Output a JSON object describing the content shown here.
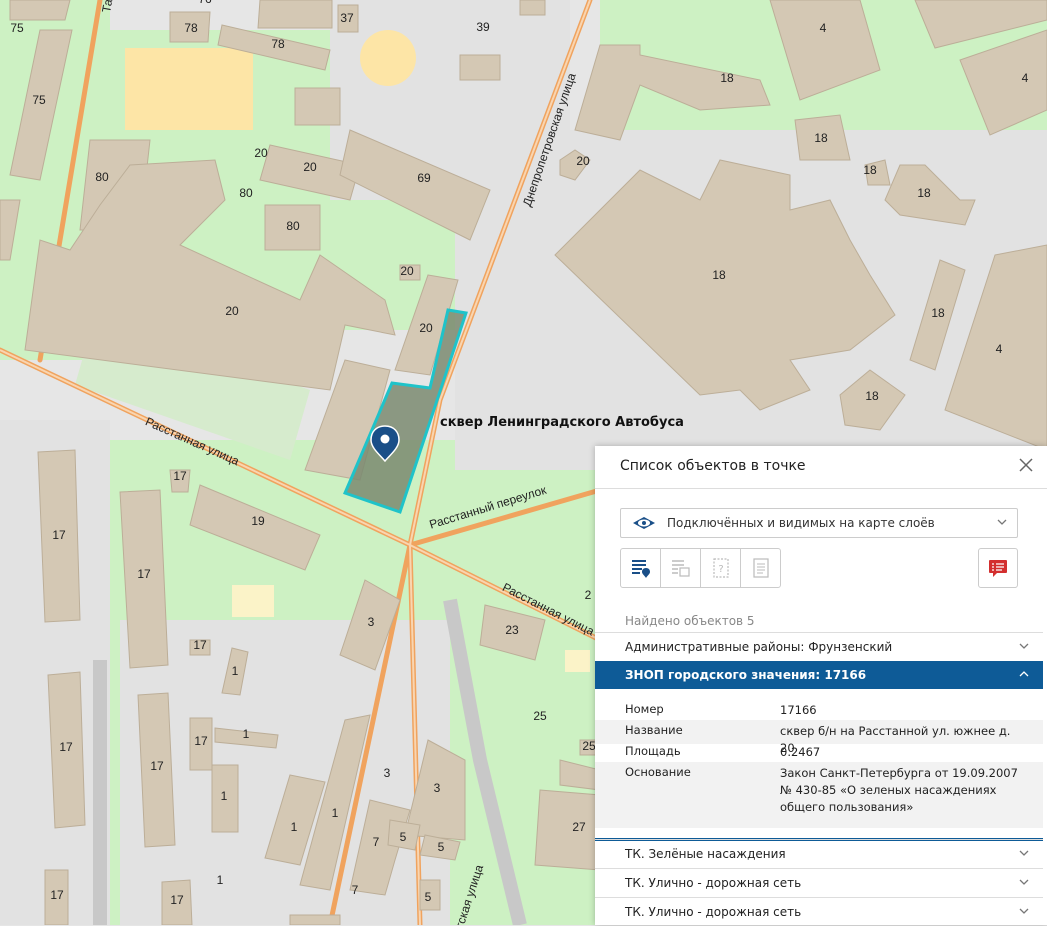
{
  "map": {
    "highlight_label": "сквер Ленинградского Автобуса",
    "streets": {
      "dnepropetrovskaya": "Днепропетровская улица",
      "rasstannaya_1": "Расстанная улица",
      "rasstannaya_2": "Расстанная улица",
      "rasstanny_per": "Расстанный переулок",
      "partial_t": "Та",
      "partial_bottom": "тская улица"
    },
    "building_numbers": {
      "b75a": "75",
      "b78a": "78",
      "b78b": "78",
      "b37": "37",
      "b39": "39",
      "b75b": "75",
      "b76": "76",
      "b18a": "18",
      "b4a": "4",
      "b4b": "4",
      "b18b": "18",
      "b20a": "20",
      "b80a": "80",
      "b20b": "20",
      "b20c": "20",
      "b69": "69",
      "b80b": "80",
      "b80c": "80",
      "b18c": "18",
      "b18d": "18",
      "b18big": "18",
      "b20d": "20",
      "b20e": "20",
      "b20main": "20",
      "b18e": "18",
      "b4c": "4",
      "b18f": "18",
      "b17a": "17",
      "b17b": "17",
      "b17c": "17",
      "b19": "19",
      "b3a": "3",
      "b23": "23",
      "b17d": "17",
      "b1a": "1",
      "b17e": "17",
      "b1b": "1",
      "b17f": "17",
      "b1c": "1",
      "b25": "25",
      "b25b": "25",
      "b3b": "3",
      "b3c": "3",
      "b1d": "1",
      "b1e": "1",
      "b7a": "7",
      "b5a": "5",
      "b5b": "5",
      "b7b": "7",
      "b27": "27",
      "b17g": "17",
      "b17h": "17",
      "b1f": "1",
      "b5c": "5",
      "b2": "2"
    },
    "colors": {
      "building": "#d4c8b4",
      "green": "#cdf1c3",
      "road": "#f0a35e",
      "highlight_stroke": "#1fc3c9",
      "highlight_fill": "#7a8a70"
    }
  },
  "panel": {
    "title": "Список объектов в точке",
    "layer_select": "Подключённых и видимых на карте слоёв",
    "found_text": "Найдено объектов 5",
    "rows": [
      {
        "label": "Административные районы: Фрунзенский"
      },
      {
        "label": "ЗНОП городского значения: 17166"
      }
    ],
    "details": [
      {
        "key": "Номер",
        "value": "17166"
      },
      {
        "key": "Название",
        "value": "сквер б/н на Расстанной ул. южнее д. 20"
      },
      {
        "key": "Площадь",
        "value": "0.2467"
      },
      {
        "key": "Основание",
        "value": "Закон Санкт-Петербурга от 19.09.2007 № 430-85 «О зеленых насаждениях общего пользования»"
      }
    ],
    "more_rows": [
      {
        "label": "ТК. Зелёные насаждения"
      },
      {
        "label": "ТК. Улично - дорожная сеть"
      },
      {
        "label": "ТК. Улично - дорожная сеть"
      }
    ],
    "colors": {
      "accent": "#0e5b97",
      "report": "#d32f2f"
    }
  }
}
